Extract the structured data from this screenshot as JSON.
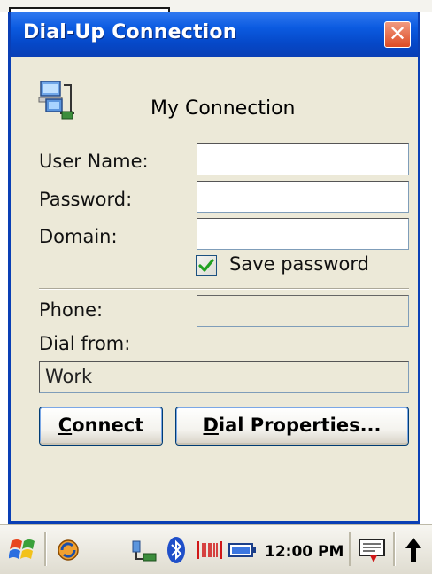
{
  "window": {
    "title": "Dial-Up Connection",
    "close_glyph": "✕"
  },
  "connection": {
    "name": "My Connection",
    "icon": "network-computers-icon"
  },
  "form": {
    "username": {
      "label": "User Name:",
      "value": ""
    },
    "password": {
      "label": "Password:",
      "value": ""
    },
    "domain": {
      "label": "Domain:",
      "value": ""
    },
    "save_password": {
      "label": "Save password",
      "checked": true
    },
    "phone": {
      "label": "Phone:",
      "value": ""
    },
    "dial_from": {
      "label": "Dial from:",
      "value": "Work"
    }
  },
  "buttons": {
    "connect": {
      "mnemonic": "C",
      "rest": "onnect"
    },
    "dial_properties": {
      "mnemonic": "D",
      "rest": "ial Properties..."
    }
  },
  "taskbar": {
    "clock": "12:00 PM",
    "icons": [
      "start-flag-icon",
      "sync-icon",
      "network-icon",
      "bluetooth-icon",
      "barcode-scanner-icon",
      "battery-icon",
      "keyboard-icon",
      "up-arrow-icon"
    ]
  },
  "colors": {
    "title_blue": "#0a3fb5",
    "face": "#ece9d8",
    "close_red": "#dd4b24",
    "check_green": "#21a121"
  }
}
